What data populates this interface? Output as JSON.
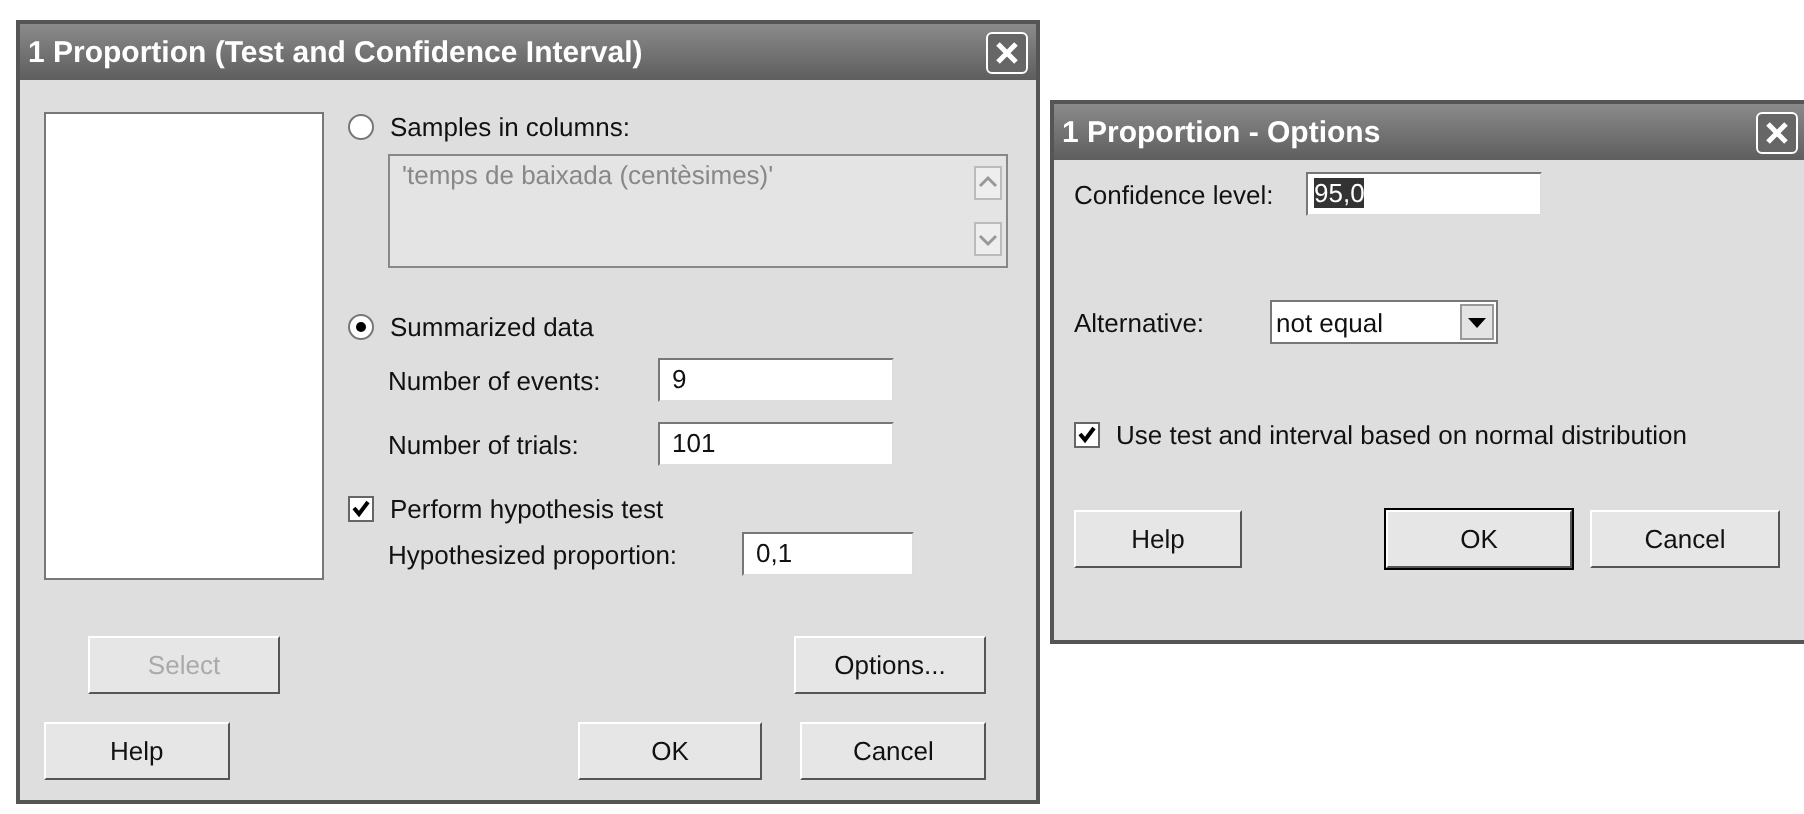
{
  "main_dialog": {
    "title": "1 Proportion (Test and Confidence Interval)",
    "samples_option": {
      "label": "Samples in columns:",
      "selected": false,
      "value": "'temps de baixada (centèsimes)'",
      "disabled": true
    },
    "summarized_option": {
      "label": "Summarized data",
      "selected": true
    },
    "fields": [
      {
        "label": "Number of events:",
        "value": "9"
      },
      {
        "label": "Number of trials:",
        "value": "101"
      }
    ],
    "hypothesis_test": {
      "label": "Perform hypothesis test",
      "checked": true
    },
    "hypothesized_proportion": {
      "label": "Hypothesized proportion:",
      "value": "0,1"
    },
    "button_rows": [
      [
        {
          "label": "Select",
          "disabled": true,
          "default": false
        },
        {
          "label": "Options...",
          "disabled": false,
          "default": false
        }
      ],
      [
        {
          "label": "Help",
          "disabled": false,
          "default": false
        },
        {
          "label": "OK",
          "disabled": false,
          "default": false
        },
        {
          "label": "Cancel",
          "disabled": false,
          "default": false
        }
      ]
    ]
  },
  "options_dialog": {
    "title": "1 Proportion - Options",
    "confidence_level": {
      "label": "Confidence level:",
      "value": "95,0",
      "text_selected": true
    },
    "alternative": {
      "label": "Alternative:",
      "value": "not equal"
    },
    "normal_distribution": {
      "label": "Use test and interval based on normal distribution",
      "checked": true
    },
    "buttons": [
      {
        "label": "Help",
        "disabled": false,
        "default": false
      },
      {
        "label": "OK",
        "disabled": false,
        "default": true
      },
      {
        "label": "Cancel",
        "disabled": false,
        "default": false
      }
    ]
  }
}
